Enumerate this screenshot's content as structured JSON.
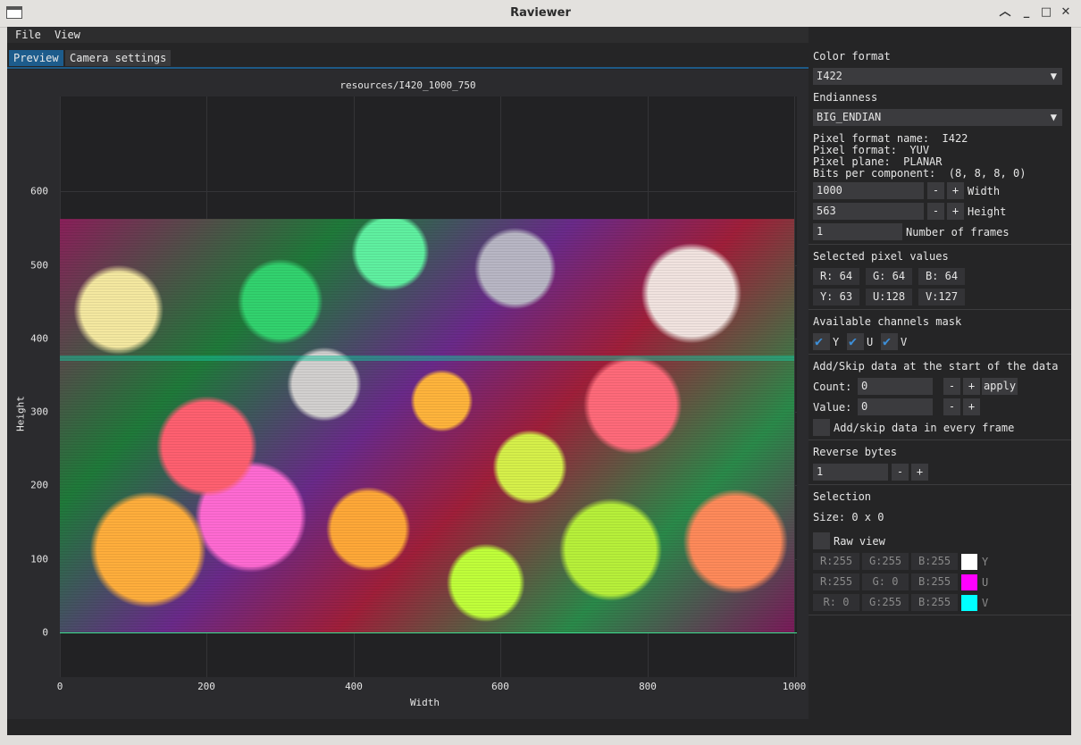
{
  "window": {
    "title": "Raviewer"
  },
  "menu": {
    "file": "File",
    "view": "View"
  },
  "tabs": {
    "preview": "Preview",
    "camera": "Camera settings"
  },
  "plot": {
    "title": "resources/I420_1000_750",
    "xlabel": "Width",
    "ylabel": "Height",
    "xticks": [
      "0",
      "200",
      "400",
      "600",
      "800",
      "1000"
    ],
    "yticks": [
      "0",
      "100",
      "200",
      "300",
      "400",
      "500",
      "600"
    ]
  },
  "panel": {
    "color_format_label": "Color format",
    "color_format_value": "I422",
    "endianness_label": "Endianness",
    "endianness_value": "BIG_ENDIAN",
    "pf_name": "Pixel format name:  I422",
    "pf_format": "Pixel format:  YUV",
    "pf_plane": "Pixel plane:  PLANAR",
    "pf_bits": "Bits per component:  (8, 8, 8, 0)",
    "width_value": "1000",
    "width_label": "Width",
    "height_value": "563",
    "height_label": "Height",
    "frames_value": "1",
    "frames_label": "Number of frames",
    "selected_label": "Selected pixel values",
    "r": "R: 64",
    "g": "G: 64",
    "b": "B: 64",
    "y": "Y: 63",
    "u": "U:128",
    "v": "V:127",
    "mask_label": "Available channels mask",
    "mask_y": "Y",
    "mask_u": "U",
    "mask_v": "V",
    "addskip_label": "Add/Skip data at the start of the data",
    "count_label": "Count:",
    "count_value": "0",
    "apply": "apply",
    "value_label": "Value:",
    "value_value": "0",
    "every_frame": "Add/skip data in every frame",
    "reverse_label": "Reverse bytes",
    "reverse_value": "1",
    "selection_label": "Selection",
    "size": "Size: 0 x 0",
    "raw_view": "Raw view",
    "raw": [
      {
        "r": "R:255",
        "g": "G:255",
        "b": "B:255",
        "name": "Y",
        "color": "#ffffff"
      },
      {
        "r": "R:255",
        "g": "G:  0",
        "b": "B:255",
        "name": "U",
        "color": "#ff00ff"
      },
      {
        "r": "R:  0",
        "g": "G:255",
        "b": "B:255",
        "name": "V",
        "color": "#00ffff"
      }
    ],
    "minus": "-",
    "plus": "+"
  }
}
